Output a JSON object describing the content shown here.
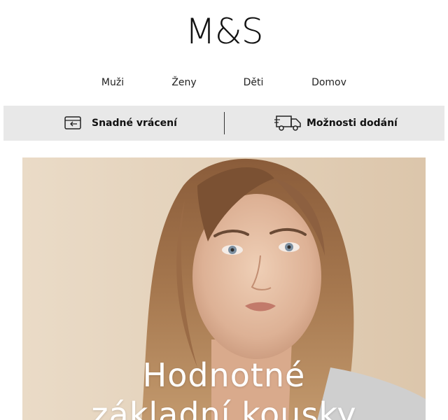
{
  "brand": {
    "logo_text": "M&S"
  },
  "nav": {
    "items": [
      {
        "label": "Muži"
      },
      {
        "label": "Ženy"
      },
      {
        "label": "Děti"
      },
      {
        "label": "Domov"
      }
    ]
  },
  "services": {
    "returns": {
      "label": "Snadné vrácení",
      "icon": "returns-card-icon"
    },
    "delivery": {
      "label": "Možnosti dodání",
      "icon": "delivery-truck-icon"
    },
    "bar_color": "#e8e8e8"
  },
  "hero": {
    "headline_line1": "Hodnotné",
    "headline_line2": "základní kousky",
    "background_color": "#e7d6c0",
    "headline_color": "#ffffff"
  }
}
